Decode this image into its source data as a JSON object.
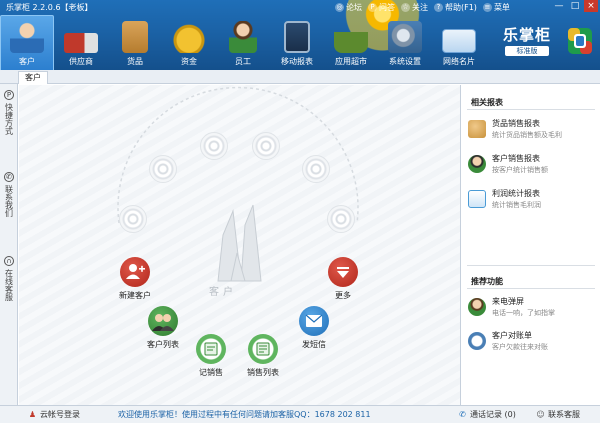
{
  "app": {
    "title": "乐掌柜 2.2.0.6【老板】",
    "brand_name": "乐掌柜",
    "brand_edition": "标准版"
  },
  "top_links": [
    {
      "label": "论坛",
      "icon": "forum-icon"
    },
    {
      "label": "问答",
      "icon": "question-icon"
    },
    {
      "label": "关注",
      "icon": "follow-icon"
    },
    {
      "label": "帮助(F1)",
      "icon": "help-icon"
    },
    {
      "label": "菜单",
      "icon": "menu-icon"
    }
  ],
  "window_controls": [
    "—",
    "□",
    "×"
  ],
  "nav": [
    {
      "label": "客户",
      "icon": "customer-icon",
      "color": "#2b6cb5",
      "active": true
    },
    {
      "label": "供应商",
      "icon": "truck-icon",
      "color": "#c0392b"
    },
    {
      "label": "货品",
      "icon": "boxes-icon",
      "color": "#c8913a"
    },
    {
      "label": "资金",
      "icon": "money-bag-icon",
      "color": "#d4a017"
    },
    {
      "label": "员工",
      "icon": "staff-icon",
      "color": "#3a8b3a"
    },
    {
      "label": "移动报表",
      "icon": "tablet-report-icon",
      "color": "#2b4a6f"
    },
    {
      "label": "应用超市",
      "icon": "basket-icon",
      "color": "#5c8a2e"
    },
    {
      "label": "系统设置",
      "icon": "gear-monitor-icon",
      "color": "#4a7fb5"
    },
    {
      "label": "网络名片",
      "icon": "name-card-icon",
      "color": "#6fa3d6"
    }
  ],
  "tabs": [
    {
      "label": "客户"
    }
  ],
  "leftbar": [
    {
      "label": "快捷方式",
      "icon": "shortcut-icon"
    },
    {
      "label": "联系我们",
      "icon": "contact-icon"
    },
    {
      "label": "在线客服",
      "icon": "headset-icon"
    }
  ],
  "main": {
    "center_label": "客户",
    "nodes": [
      {
        "id": "new-customer",
        "label": "新建客户",
        "icon": "add-user-icon",
        "color": "#c0392b"
      },
      {
        "id": "more",
        "label": "更多",
        "icon": "dropdown-icon",
        "color": "#c0392b"
      },
      {
        "id": "customer-list",
        "label": "客户列表",
        "icon": "people-icon",
        "color": "#3a8b3a"
      },
      {
        "id": "send-sms",
        "label": "发短信",
        "icon": "envelope-icon",
        "color": "#2e86c1"
      },
      {
        "id": "record-sale",
        "label": "记销售",
        "icon": "sales-note-icon",
        "color": "#3a8b3a"
      },
      {
        "id": "sales-list",
        "label": "销售列表",
        "icon": "sales-list-icon",
        "color": "#3a8b3a"
      }
    ]
  },
  "right_panel": {
    "reports_title": "相关报表",
    "reports": [
      {
        "title": "货品销售报表",
        "subtitle": "统计货品销售额及毛利",
        "icon": "goods-report-icon",
        "color": "#c8913a"
      },
      {
        "title": "客户销售报表",
        "subtitle": "按客户统计销售额",
        "icon": "customer-report-icon",
        "color": "#3a8b3a"
      },
      {
        "title": "利润统计报表",
        "subtitle": "统计销售毛利润",
        "icon": "profit-chart-icon",
        "color": "#4a9bd6"
      }
    ],
    "recommend_title": "推荐功能",
    "recommends": [
      {
        "title": "来电弹屏",
        "subtitle": "电话一响，了如指掌",
        "icon": "caller-icon",
        "color": "#3a8b3a"
      },
      {
        "title": "客户对账单",
        "subtitle": "客户欠款往来对账",
        "icon": "statement-icon",
        "color": "#4a7fb5"
      }
    ]
  },
  "status": {
    "account_login": "云帐号登录",
    "welcome_message": "欢迎使用乐掌柜！使用过程中有任何问题请加客服QQ：1678 202 811",
    "call_log": "通话记录 (0)",
    "contact_support": "联系客服"
  }
}
